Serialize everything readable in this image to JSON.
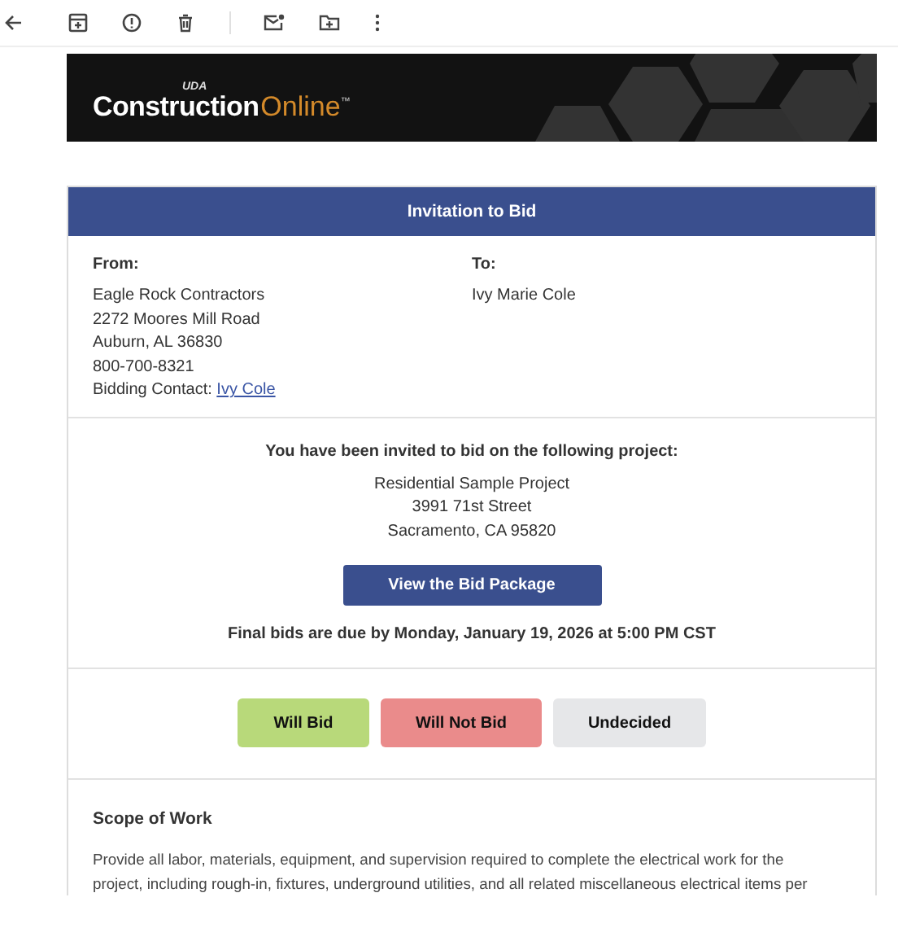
{
  "toolbar": {
    "actions": [
      {
        "kind": "back"
      },
      {
        "kind": "archive"
      },
      {
        "kind": "spam"
      },
      {
        "kind": "delete"
      },
      {
        "kind": "separator"
      },
      {
        "kind": "unread"
      },
      {
        "kind": "move"
      },
      {
        "kind": "more"
      }
    ]
  },
  "banner": {
    "logo_prefix": "UDA",
    "logo_main": "Construction",
    "logo_accent": "Online",
    "logo_mark": "™"
  },
  "card": {
    "title": "Invitation to Bid",
    "from": {
      "label": "From:",
      "lines": [
        "Eagle Rock Contractors",
        "2272 Moores Mill Road",
        "Auburn, AL 36830",
        "800-700-8321"
      ],
      "contact_label": "Bidding Contact:",
      "contact_link": "Ivy Cole"
    },
    "to": {
      "label": "To:",
      "lines": [
        "Ivy Marie Cole"
      ]
    },
    "invitation": {
      "heading": "You have been invited to bid on the following project:",
      "project_lines": [
        "Residential Sample Project",
        "3991 71st Street",
        "Sacramento, CA 95820"
      ],
      "button": "View the Bid Package",
      "deadline": "Final bids are due by Monday, January 19, 2026 at 5:00 PM CST"
    },
    "responses": [
      {
        "label": "Will Bid",
        "color": "#b8d97a"
      },
      {
        "label": "Will Not Bid",
        "color": "#ea8b8b"
      },
      {
        "label": "Undecided",
        "color": "#e6e7e9"
      }
    ],
    "scope": {
      "heading": "Scope of Work",
      "lines": [
        "Provide all labor, materials, equipment, and supervision required to complete the electrical work for the",
        "project, including rough-in, fixtures, underground utilities, and all related miscellaneous electrical items per"
      ]
    }
  }
}
